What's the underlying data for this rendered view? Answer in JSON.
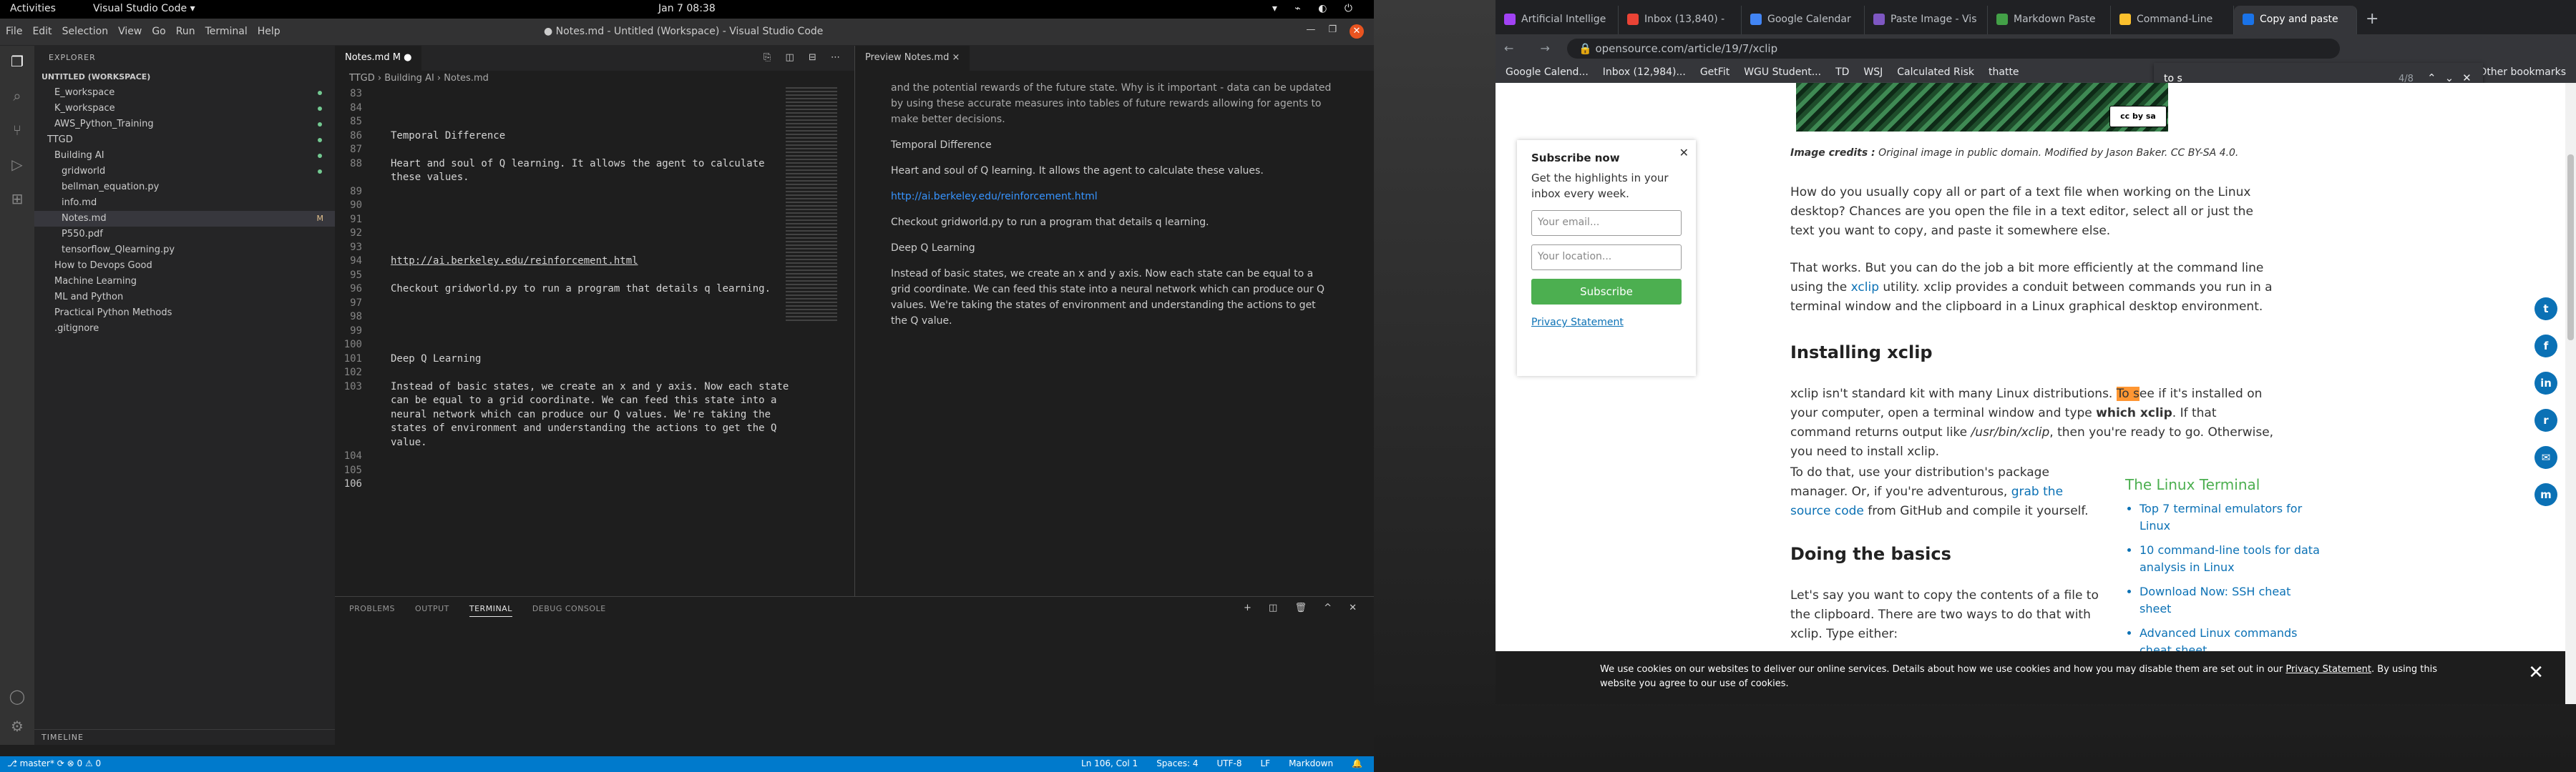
{
  "topbar": {
    "activities": "Activities",
    "app": "Visual Studio Code ▾",
    "clock": "Jan 7  08:38"
  },
  "vscode": {
    "title": "● Notes.md - Untitled (Workspace) - Visual Studio Code",
    "menu": [
      "File",
      "Edit",
      "Selection",
      "View",
      "Go",
      "Run",
      "Terminal",
      "Help"
    ],
    "explorer": {
      "header": "EXPLORER",
      "workspace": "UNTITLED (WORKSPACE)",
      "items": [
        {
          "label": "E_workspace",
          "indent": 1,
          "mark": "dot"
        },
        {
          "label": "K_workspace",
          "indent": 1,
          "mark": "dot"
        },
        {
          "label": "AWS_Python_Training",
          "indent": 1,
          "mark": "dot"
        },
        {
          "label": "TTGD",
          "indent": 0,
          "mark": "dot"
        },
        {
          "label": "Building AI",
          "indent": 1,
          "mark": "dot"
        },
        {
          "label": "gridworld",
          "indent": 2,
          "mark": "dot"
        },
        {
          "label": "bellman_equation.py",
          "indent": 2,
          "mark": ""
        },
        {
          "label": "info.md",
          "indent": 2,
          "mark": ""
        },
        {
          "label": "Notes.md",
          "indent": 2,
          "mark": "M"
        },
        {
          "label": "P550.pdf",
          "indent": 2,
          "mark": ""
        },
        {
          "label": "tensorflow_Qlearning.py",
          "indent": 2,
          "mark": ""
        },
        {
          "label": "How to Devops Good",
          "indent": 1,
          "mark": ""
        },
        {
          "label": "Machine Learning",
          "indent": 1,
          "mark": ""
        },
        {
          "label": "ML and Python",
          "indent": 1,
          "mark": ""
        },
        {
          "label": "Practical Python Methods",
          "indent": 1,
          "mark": ""
        },
        {
          "label": ".gitignore",
          "indent": 1,
          "mark": ""
        }
      ],
      "timeline": "TIMELINE"
    },
    "editor": {
      "tab": "Notes.md M ●",
      "breadcrumb": "TTGD  ›  Building AI  ›  Notes.md",
      "lines": [
        {
          "n": "83",
          "t": ""
        },
        {
          "n": "84",
          "t": ""
        },
        {
          "n": "85",
          "t": ""
        },
        {
          "n": "86",
          "t": "Temporal Difference"
        },
        {
          "n": "87",
          "t": ""
        },
        {
          "n": "88",
          "t": "Heart and soul of Q learning. It allows the agent to calculate"
        },
        {
          "n": "",
          "t": "these values."
        },
        {
          "n": "89",
          "t": ""
        },
        {
          "n": "90",
          "t": ""
        },
        {
          "n": "91",
          "t": ""
        },
        {
          "n": "92",
          "t": ""
        },
        {
          "n": "93",
          "t": ""
        },
        {
          "n": "94",
          "t": "http://ai.berkeley.edu/reinforcement.html"
        },
        {
          "n": "95",
          "t": ""
        },
        {
          "n": "96",
          "t": "Checkout gridworld.py to run a program that details q learning."
        },
        {
          "n": "97",
          "t": ""
        },
        {
          "n": "98",
          "t": ""
        },
        {
          "n": "99",
          "t": ""
        },
        {
          "n": "100",
          "t": ""
        },
        {
          "n": "101",
          "t": "Deep Q Learning"
        },
        {
          "n": "102",
          "t": ""
        },
        {
          "n": "103",
          "t": "Instead of basic states, we create an x and y axis. Now each state"
        },
        {
          "n": "",
          "t": "can be equal to a grid coordinate. We can feed this state into a"
        },
        {
          "n": "",
          "t": "neural network which can produce our Q values. We're taking the"
        },
        {
          "n": "",
          "t": "states of environment and understanding the actions to get the Q"
        },
        {
          "n": "",
          "t": "value."
        },
        {
          "n": "104",
          "t": ""
        },
        {
          "n": "105",
          "t": ""
        },
        {
          "n": "106",
          "t": ""
        }
      ]
    },
    "preview": {
      "tab": "Preview Notes.md ×",
      "p0": "and the potential rewards of the future state. Why is it important - data can be updated by using these accurate measures into tables of future rewards allowing for agents to make better decisions.",
      "p1": "Temporal Difference",
      "p2": "Heart and soul of Q learning. It allows the agent to calculate these values.",
      "p3": "http://ai.berkeley.edu/reinforcement.html",
      "p4": "Checkout gridworld.py to run a program that details q learning.",
      "p5": "Deep Q Learning",
      "p6": "Instead of basic states, we create an x and y axis. Now each state can be equal to a grid coordinate. We can feed this state into a neural network which can produce our Q values. We're taking the states of environment and understanding the actions to get the Q value."
    },
    "panel": {
      "tabs": [
        "PROBLEMS",
        "OUTPUT",
        "TERMINAL",
        "DEBUG CONSOLE"
      ],
      "active": 2
    },
    "status": {
      "left": "⎇ master*  ⟳  ⊗ 0 ⚠ 0",
      "right": [
        "Ln 106, Col 1",
        "Spaces: 4",
        "UTF-8",
        "LF",
        "Markdown"
      ]
    }
  },
  "chrome": {
    "tabs": [
      {
        "label": "Artificial Intellige",
        "color": "#a142f4"
      },
      {
        "label": "Inbox (13,840) - ",
        "color": "#ea4335"
      },
      {
        "label": "Google Calendar",
        "color": "#4285f4"
      },
      {
        "label": "Paste Image - Vis",
        "color": "#7e57c2"
      },
      {
        "label": "Markdown Paste",
        "color": "#43a047"
      },
      {
        "label": "Command-Line",
        "color": "#fbc02d"
      },
      {
        "label": "Copy and paste",
        "color": "#1a73e8"
      }
    ],
    "active_tab": 6,
    "url": "opensource.com/article/19/7/xclip",
    "bookmarks": [
      "Google Calend...",
      "Inbox (12,984)...",
      "GetFit",
      "WGU Student...",
      "TD",
      "WSJ",
      "Calculated Risk",
      "thatte",
      "Other bookmarks"
    ],
    "find": {
      "query": "to s",
      "count": "4/8"
    },
    "page": {
      "credit_label": "Image credits :",
      "credit": "Original image in public domain. Modified by Jason Baker. CC BY-SA 4.0.",
      "p1": "How do you usually copy all or part of a text file when working on the Linux desktop? Chances are you open the file in a text editor, select all or just the text you want to copy, and paste it somewhere else.",
      "p2a": "That works. But you can do the job a bit more efficiently at the command line using the ",
      "p2link": "xclip",
      "p2b": " utility. xclip provides a conduit between commands you run in a terminal window and the clipboard in a Linux graphical desktop environment.",
      "h1": "Installing xclip",
      "p3a": "xclip isn't standard kit with many Linux distributions. ",
      "p3hl": "To s",
      "p3b": "ee if it's installed on your computer, open a terminal window and type ",
      "p3bold": "which xclip",
      "p3c": ". If that command returns output like ",
      "p3code": "/usr/bin/xclip",
      "p3d": ", then you're ready to go. Otherwise, you need to install xclip.",
      "p4a": "To do that, use your distribution's package manager. Or, if you're adventurous, ",
      "p4link": "grab the source code",
      "p4b": " from GitHub and compile it yourself.",
      "h2": "Doing the basics",
      "p5": "Let's say you want to copy the contents of a file to the clipboard. There are two ways to do that with xclip. Type either:",
      "subscribe": {
        "title": "Subscribe now",
        "desc": "Get the highlights in your inbox every week.",
        "email": "Your email...",
        "location": "Your location...",
        "button": "Subscribe",
        "privacy": "Privacy Statement"
      },
      "sidebox": {
        "title": "The Linux Terminal",
        "links": [
          "Top 7 terminal emulators for Linux",
          "10 command-line tools for data analysis in Linux",
          "Download Now: SSH cheat sheet",
          "Advanced Linux commands cheat sheet"
        ]
      },
      "social": [
        "t",
        "f",
        "in",
        "r",
        "✉",
        "m"
      ],
      "cookie_a": "We use cookies on our websites to deliver our online services. Details about how we use cookies and how you may disable them are set out in our ",
      "cookie_link": "Privacy Statement",
      "cookie_b": ". By using this website you agree to our use of cookies."
    }
  }
}
